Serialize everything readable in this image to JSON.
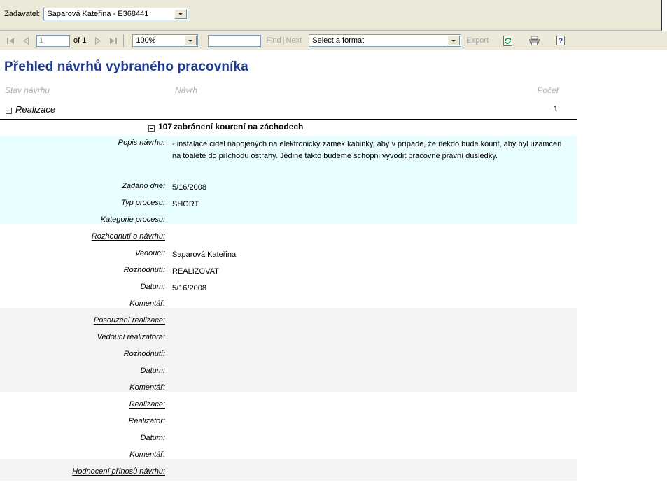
{
  "parameter_bar": {
    "label": "Zadavatel:",
    "selected": "Saparová  Kateřina - E368441"
  },
  "toolbar": {
    "page_value": "1",
    "page_total_label": "of 1",
    "zoom_value": "100%",
    "find_placeholder": "",
    "find_label": "Find",
    "pipe": "|",
    "next_label": "Next",
    "format_value": "Select a format",
    "export_label": "Export",
    "icons": {
      "first_page": "first-page-icon",
      "prev_page": "previous-page-icon",
      "next_page": "next-page-icon",
      "last_page": "last-page-icon",
      "refresh": "refresh-icon",
      "print": "print-icon",
      "help": "help-icon"
    }
  },
  "report": {
    "title": "Přehled návrhů vybraného pracovníka",
    "columns": {
      "stav": "Stav návrhu",
      "navrh": "Návrh",
      "pocet": "Počet"
    },
    "group": {
      "label": "Realizace",
      "count": "1"
    },
    "proposal": {
      "number": "107",
      "name": "zabránení kourení na záchodech"
    },
    "fields": {
      "popis_label": "Popis návrhu:",
      "popis_value": "- instalace cidel napojených na elektronický zámek kabinky, aby v prípade, že nekdo bude kourit, aby byl uzamcen na toalete do príchodu ostrahy. Jedine takto budeme schopni vyvodit pracovne právní dusledky.",
      "zadano_label": "Zadáno dne:",
      "zadano_value": "5/16/2008",
      "typ_label": "Typ procesu:",
      "typ_value": "SHORT",
      "kategorie_label": "Kategorie procesu:",
      "kategorie_value": "",
      "rozhodnuti_section": "Rozhodnutí o návrhu:",
      "vedouci_label": "Vedoucí:",
      "vedouci_value": "Saparová Kateřina",
      "rozhodnuti_label": "Rozhodnutí:",
      "rozhodnuti_value": "REALIZOVAT",
      "datum_label": "Datum:",
      "datum_value": "5/16/2008",
      "komentar_label": "Komentář:",
      "komentar_value": "",
      "posouzeni_section": "Posouzení realizace:",
      "vedouci_real_label": "Vedoucí realizátora:",
      "vedouci_real_value": "",
      "posouzeni_rozhodnuti_label": "Rozhodnutí:",
      "posouzeni_rozhodnuti_value": "",
      "posouzeni_datum_label": "Datum:",
      "posouzeni_datum_value": "",
      "posouzeni_komentar_label": "Komentář:",
      "posouzeni_komentar_value": "",
      "realizace_section": "Realizace:",
      "realizator_label": "Realizátor:",
      "realizator_value": "",
      "realizace_datum_label": "Datum:",
      "realizace_datum_value": "",
      "realizace_komentar_label": "Komentář:",
      "realizace_komentar_value": "",
      "hodnoceni_section": "Hodnocení přínosů návrhu:"
    }
  },
  "colors": {
    "title": "#1F3A93",
    "chrome": "#ECE9D8",
    "band_blue": "#E9FEFF",
    "band_gray": "#F4F4F4",
    "header_text": "#B1B1B1"
  }
}
